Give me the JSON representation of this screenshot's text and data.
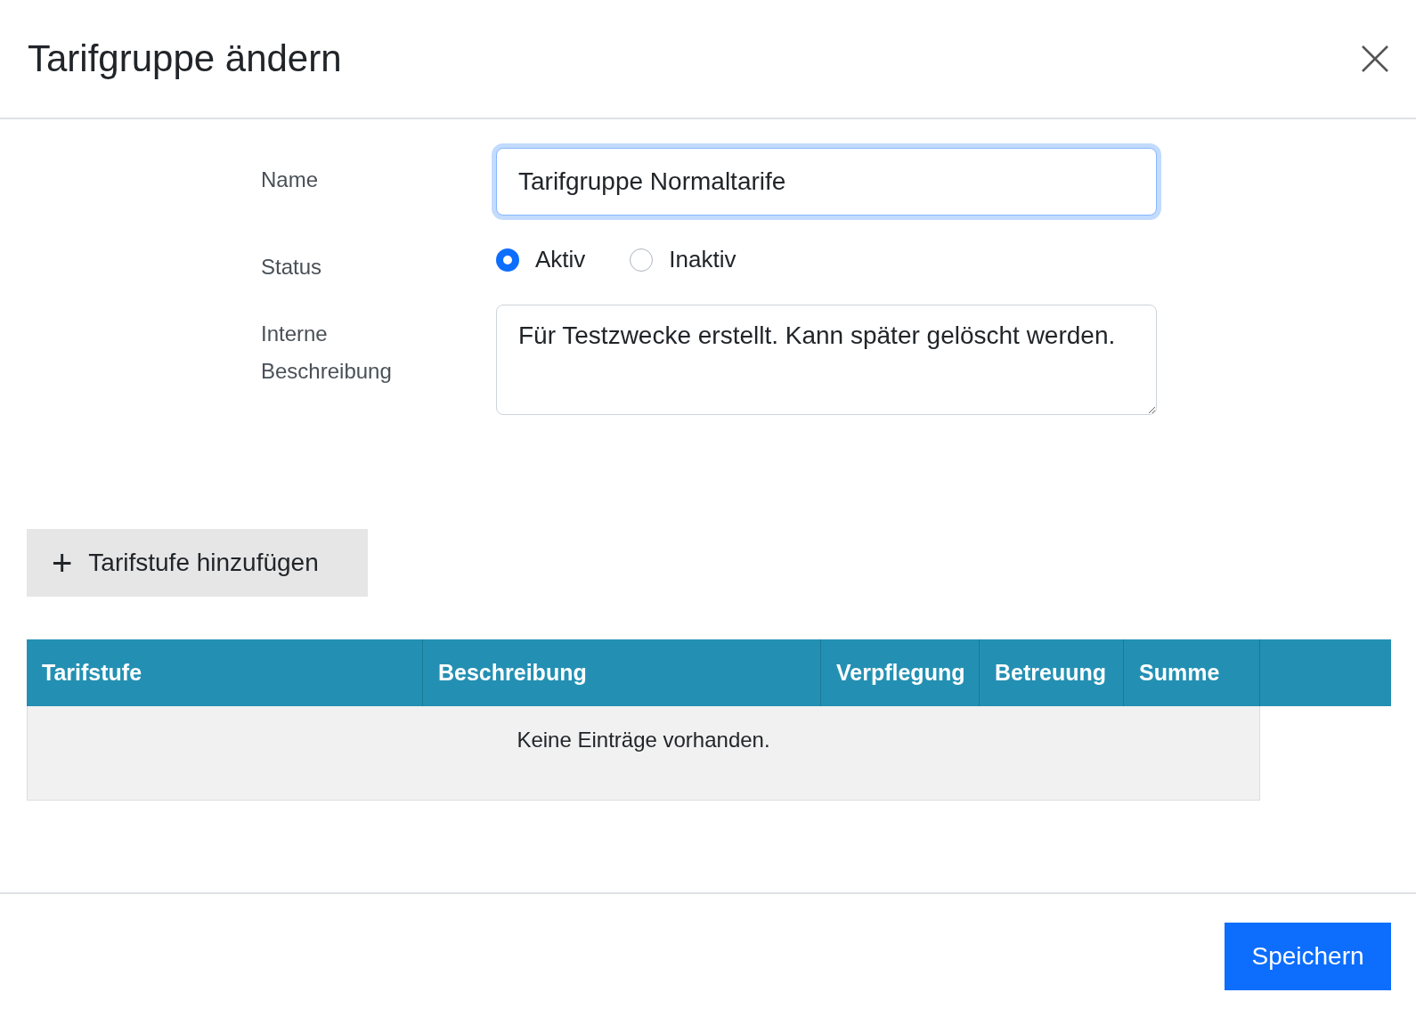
{
  "dialog": {
    "title": "Tarifgruppe ändern"
  },
  "form": {
    "name": {
      "label": "Name",
      "value": "Tarifgruppe Normaltarife",
      "focused": true
    },
    "status": {
      "label": "Status",
      "options": [
        {
          "label": "Aktiv",
          "selected": true
        },
        {
          "label": "Inaktiv",
          "selected": false
        }
      ]
    },
    "description": {
      "label": "Interne Beschreibung",
      "value": "Für Testzwecke erstellt. Kann später gelöscht werden."
    }
  },
  "add_button": {
    "icon": "+",
    "label": "Tarifstufe hinzufügen"
  },
  "table": {
    "columns": [
      "Tarifstufe",
      "Beschreibung",
      "Verpflegung",
      "Betreuung",
      "Summe"
    ],
    "empty_message": "Keine Einträge vorhanden."
  },
  "footer": {
    "save_button": "Speichern"
  }
}
